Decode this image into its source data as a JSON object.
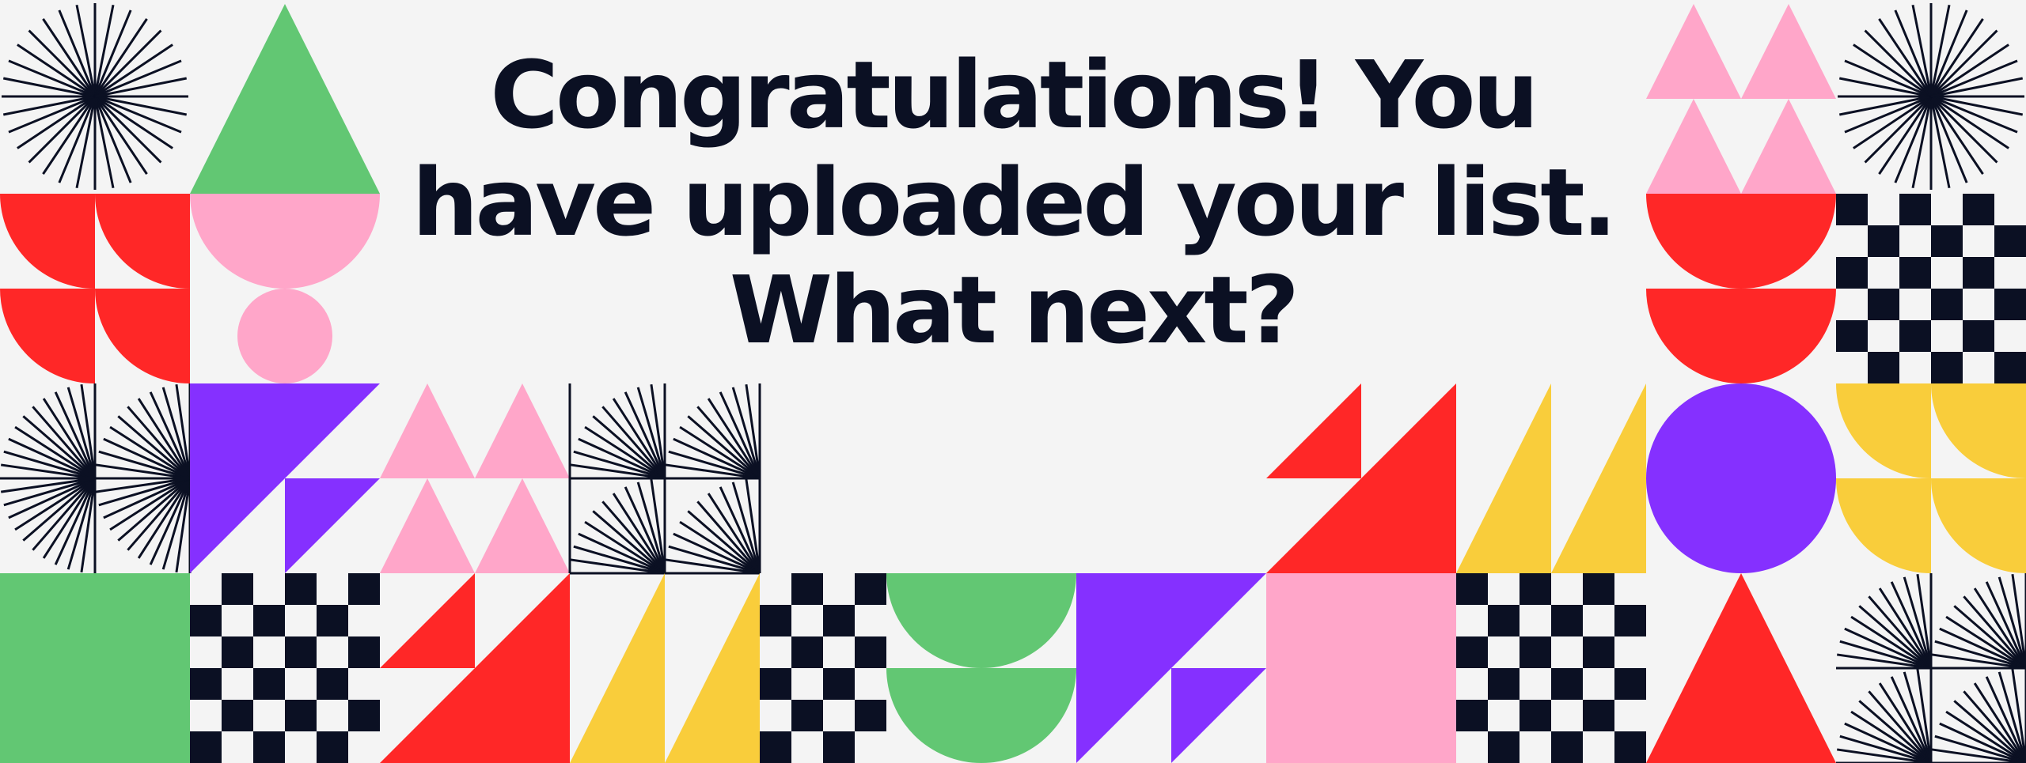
{
  "heading": {
    "line1": "Congratulations! You",
    "line2": "have uploaded your list.",
    "line3": "What next?"
  },
  "colors": {
    "background": "#f4f4f4",
    "ink": "#0b1023",
    "green": "#62c773",
    "pink": "#ffa6c9",
    "red": "#ff2727",
    "purple": "#8530ff",
    "yellow": "#f9cd3b"
  },
  "decor_icons": [
    "sunburst-icon",
    "triangle-shape",
    "semicircle-shape",
    "circle-shape",
    "checkerboard-pattern",
    "quarter-circle-shape"
  ]
}
